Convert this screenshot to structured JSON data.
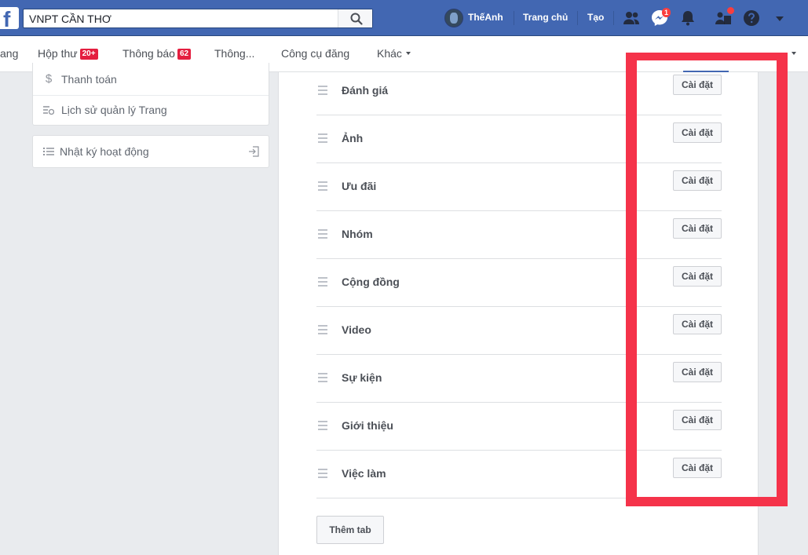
{
  "topbar": {
    "search_value": "VNPT CẦN THƠ",
    "user_name": "ThếAnh",
    "home_label": "Trang chủ",
    "create_label": "Tạo",
    "messenger_badge": "1"
  },
  "subnav": {
    "items": [
      {
        "label": "ang"
      },
      {
        "label": "Hộp thư",
        "badge": "20+"
      },
      {
        "label": "Thông báo",
        "badge": "62"
      },
      {
        "label": "Thông..."
      },
      {
        "label": "Công cụ đăng"
      },
      {
        "label": "Khác"
      }
    ]
  },
  "sidebar": {
    "items": [
      {
        "label": "Thanh toán",
        "icon": "dollar-icon"
      },
      {
        "label": "Lịch sử quản lý Trang",
        "icon": "history-icon"
      }
    ],
    "activity_log": {
      "label": "Nhật ký hoạt động",
      "icon": "list-icon"
    }
  },
  "tabs": {
    "items": [
      {
        "label": "Đánh giá"
      },
      {
        "label": "Ảnh"
      },
      {
        "label": "Ưu đãi"
      },
      {
        "label": "Nhóm"
      },
      {
        "label": "Cộng đồng"
      },
      {
        "label": "Video"
      },
      {
        "label": "Sự kiện"
      },
      {
        "label": "Giới thiệu"
      },
      {
        "label": "Việc làm"
      }
    ],
    "settings_label": "Cài đặt",
    "add_tab_label": "Thêm tab"
  },
  "colors": {
    "brand": "#4267b2",
    "highlight": "#f5334a",
    "badge": "#e41e3f"
  }
}
